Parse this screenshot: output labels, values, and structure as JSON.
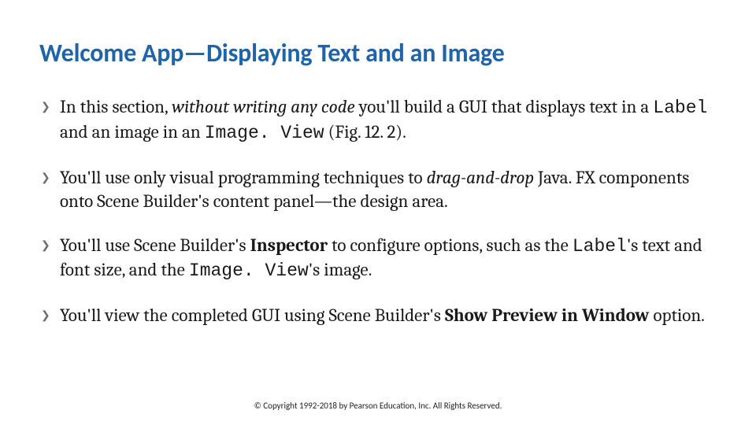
{
  "title": "Welcome App—Displaying Text and an Image",
  "bullets": [
    {
      "pre": "In this section, ",
      "ital": "without writing any code",
      "post1": " you'll build a GUI that displays text in a ",
      "code1": "Label",
      "mid": " and an image in an ",
      "code2": "Image. View",
      "post2": " (Fig. 12. 2)."
    },
    {
      "pre": "You'll use only visual programming techniques to ",
      "ital": "drag-and-drop",
      "post": " Java. FX components onto Scene Builder's content panel—the design area."
    },
    {
      "pre": "You'll use Scene Builder's ",
      "b1": "Inspector",
      "mid1": " to configure options, such as the ",
      "code1": "Label",
      "mid2": "'s text and font size, and the ",
      "code2": "Image. View",
      "post": "'s image."
    },
    {
      "pre": "You'll view the completed GUI using Scene Builder's ",
      "b1": "Show Preview in Window",
      "post": " option."
    }
  ],
  "footer": "© Copyright 1992-2018 by Pearson Education, Inc. All Rights Reserved."
}
